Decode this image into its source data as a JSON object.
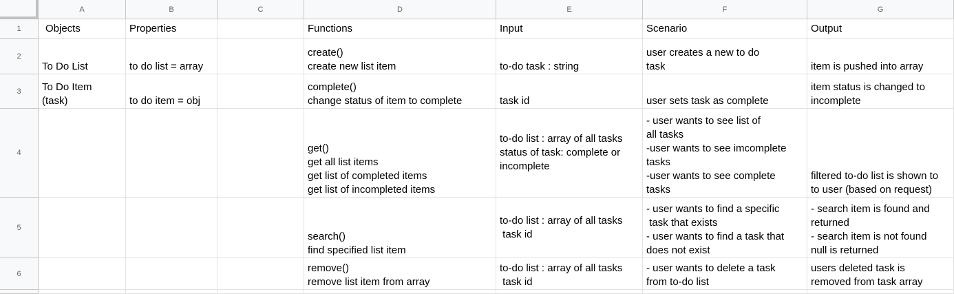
{
  "columns": [
    "A",
    "B",
    "C",
    "D",
    "E",
    "F",
    "G"
  ],
  "rows": [
    "1",
    "2",
    "3",
    "4",
    "5",
    "6"
  ],
  "cells": {
    "A1": "Objects",
    "B1": "Properties",
    "C1": "",
    "D1": "Functions",
    "E1": "Input",
    "F1": "Scenario",
    "G1": "Output",
    "A2": "To Do List",
    "B2": "to do list = array",
    "C2": "",
    "D2": "create()\ncreate new list item",
    "E2": "to-do task : string",
    "F2": "user creates a new to do\ntask",
    "G2": "item is pushed into array",
    "A3": "To Do Item\n(task)",
    "B3": "to do item = obj",
    "C3": "",
    "D3": "complete()\nchange status of item to complete",
    "E3": "task id",
    "F3": "user sets task as complete",
    "G3": "item status is changed to\nincomplete",
    "A4": "",
    "B4": "",
    "C4": "",
    "D4": "get()\nget all list items\nget list of completed items\nget list of incompleted items",
    "E4": "to-do list : array of all tasks\nstatus of task: complete or\nincomplete",
    "F4": "- user wants to see list of\nall tasks\n-user wants to see imcomplete\ntasks\n-user wants to see complete\ntasks",
    "G4": "filtered to-do list is shown to\nto user (based on request)",
    "A5": "",
    "B5": "",
    "C5": "",
    "D5": "search()\nfind specified list item",
    "E5": "to-do list : array of all tasks\n task id",
    "F5": "- user wants to find a specific\n task that exists\n- user wants to find a task that\ndoes not exist",
    "G5": "- search item is found and\nreturned\n- search item is not found\nnull is returned",
    "A6": "",
    "B6": "",
    "C6": "",
    "D6": "remove()\nremove list item from array",
    "E6": "to-do list : array of all tasks\n task id",
    "F6": "- user wants to delete a task\nfrom to-do list",
    "G6": "users deleted task is\nremoved from task array"
  }
}
